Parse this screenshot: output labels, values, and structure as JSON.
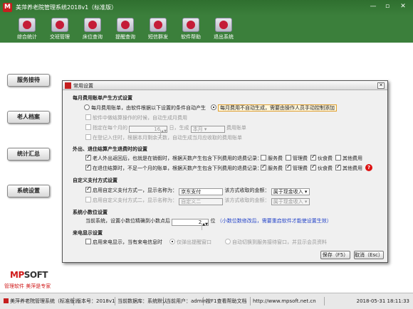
{
  "window": {
    "title": "美萍养老院管理系统2018v1（标准版）",
    "min": "—",
    "restore": "▫",
    "close": "✕"
  },
  "toolbar": [
    {
      "label": "综合统计"
    },
    {
      "label": "交班管理"
    },
    {
      "label": "床位查询"
    },
    {
      "label": "提醒查询"
    },
    {
      "label": "短信群发"
    },
    {
      "label": "软件帮助"
    },
    {
      "label": "退出系统"
    }
  ],
  "sidebar": {
    "items": [
      {
        "label": "服务接待"
      },
      {
        "label": "老人档案"
      },
      {
        "label": "统计汇总"
      },
      {
        "label": "系统设置"
      }
    ],
    "logo_a": "MP",
    "logo_b": "SOFT",
    "slogan": "管理软件   美萍是专家"
  },
  "dialog": {
    "title": "常用设置",
    "sec1": "每月费用账单产生方式设置",
    "opt_auto": "每月费用账单，由软件根据以下设置的条件自动产生",
    "opt_manual": "每月费用不自动生成，需要由操作人员手动控制添加",
    "s1_a": "软件中做结算操作的时候，自动生成月费用",
    "s1_b_pre": "指定在每个月的",
    "s1_b_day": "16",
    "s1_b_mid": "日，生成",
    "s1_b_month": "本月",
    "s1_b_post": "费用账单",
    "s1_c": "在登记入住时，根据本月剩余天数，自动生成当月应收取的费用账单",
    "sec2": "外出、退住结算产生退费时的设置",
    "s2_a": "老人外出返回后，也就是在销假时，根据天数产生包含下列费用的退费记录：",
    "s2_b": "在退住结算时，不足一个月的账单，根据天数产生包含下列费用的退费记录：",
    "fees": [
      "服务费",
      "管理费",
      "伙食费",
      "其他费用"
    ],
    "sec3": "自定义支付方式设置",
    "p1_pre": "启用自定义支付方式一，显示名称为：",
    "p1_name": "京东支付",
    "p2_pre": "启用自定义支付方式二，显示名称为：",
    "p2_name": "自定义二",
    "p_mid": "该方式收取的金额：",
    "p1_type": "属于现金收入",
    "p2_type": "属于现金收入",
    "sec4": "系统小数位设置",
    "dec_pre": "当前系统，设置小数位精确到小数点后",
    "dec_val": "2",
    "dec_post": "位",
    "dec_note": "（小数位数修改后，需要重启软件才能使设置生效）",
    "sec5": "来电显示设置",
    "cid_a": "启用来电显示，当有来电信息时",
    "cid_b": "仅弹出提醒窗口",
    "cid_c": "自动切换到服务接待窗口，并显示会员资料",
    "save": "保存（F5）",
    "cancel": "取消（Esc）"
  },
  "status": {
    "app": "美萍养老院管理系统（标准版）",
    "version": "版本号：2018v1",
    "user": "当前用户：admin",
    "db": "当前数据库：系统默认",
    "help": "按F1查看帮助文档",
    "url": "http://www.mpsoft.net.cn",
    "time": "2018-05-31 18:11:33"
  }
}
